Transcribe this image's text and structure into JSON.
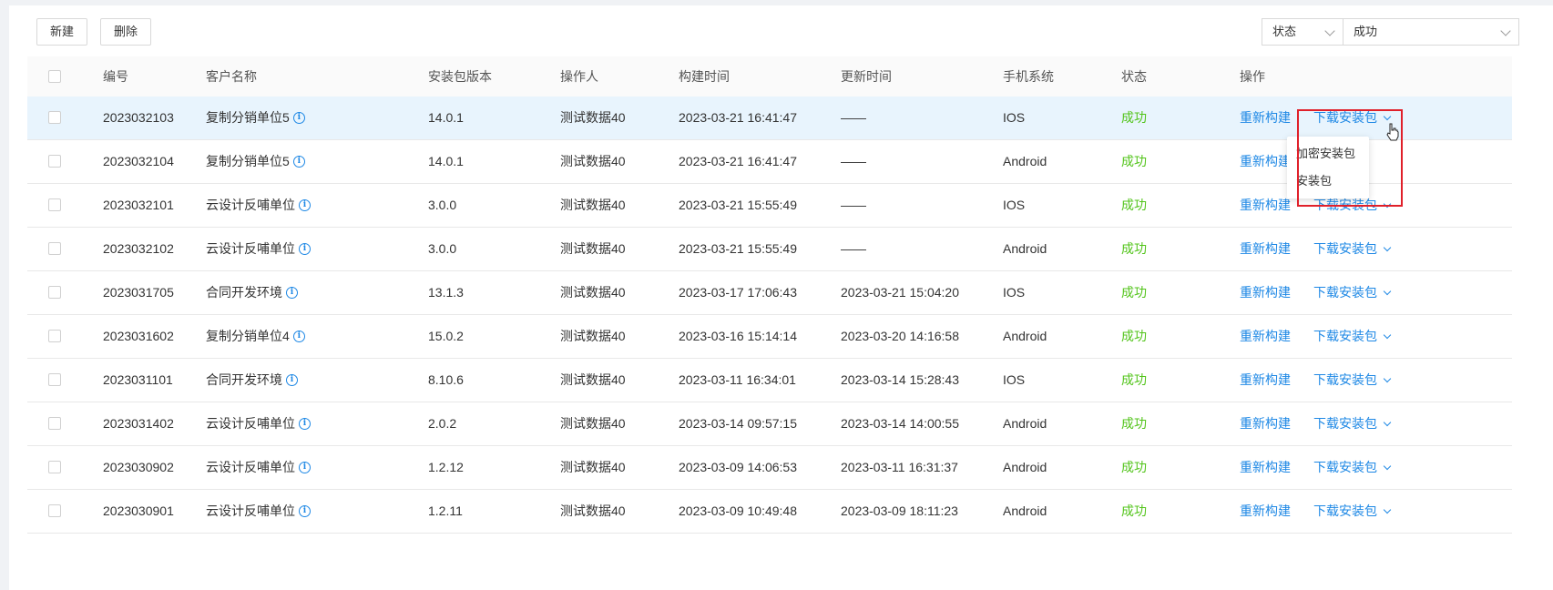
{
  "toolbar": {
    "new_label": "新建",
    "delete_label": "删除"
  },
  "filter": {
    "field_label": "状态",
    "value_label": "成功"
  },
  "columns": [
    "编号",
    "客户名称",
    "安装包版本",
    "操作人",
    "构建时间",
    "更新时间",
    "手机系统",
    "状态",
    "操作"
  ],
  "rows": [
    {
      "id": "2023032103",
      "customer": "复制分销单位5",
      "version": "14.0.1",
      "operator": "测试数据40",
      "build": "2023-03-21 16:41:47",
      "update": "——",
      "os": "IOS",
      "status": "成功",
      "rebuild": "重新构建",
      "download": "下载安装包"
    },
    {
      "id": "2023032104",
      "customer": "复制分销单位5",
      "version": "14.0.1",
      "operator": "测试数据40",
      "build": "2023-03-21 16:41:47",
      "update": "——",
      "os": "Android",
      "status": "成功",
      "rebuild": "重新构建",
      "download": ""
    },
    {
      "id": "2023032101",
      "customer": "云设计反哺单位",
      "version": "3.0.0",
      "operator": "测试数据40",
      "build": "2023-03-21 15:55:49",
      "update": "——",
      "os": "IOS",
      "status": "成功",
      "rebuild": "重新构建",
      "download": "下载安装包"
    },
    {
      "id": "2023032102",
      "customer": "云设计反哺单位",
      "version": "3.0.0",
      "operator": "测试数据40",
      "build": "2023-03-21 15:55:49",
      "update": "——",
      "os": "Android",
      "status": "成功",
      "rebuild": "重新构建",
      "download": "下载安装包"
    },
    {
      "id": "2023031705",
      "customer": "合同开发环境",
      "version": "13.1.3",
      "operator": "测试数据40",
      "build": "2023-03-17 17:06:43",
      "update": "2023-03-21 15:04:20",
      "os": "IOS",
      "status": "成功",
      "rebuild": "重新构建",
      "download": "下载安装包"
    },
    {
      "id": "2023031602",
      "customer": "复制分销单位4",
      "version": "15.0.2",
      "operator": "测试数据40",
      "build": "2023-03-16 15:14:14",
      "update": "2023-03-20 14:16:58",
      "os": "Android",
      "status": "成功",
      "rebuild": "重新构建",
      "download": "下载安装包"
    },
    {
      "id": "2023031101",
      "customer": "合同开发环境",
      "version": "8.10.6",
      "operator": "测试数据40",
      "build": "2023-03-11 16:34:01",
      "update": "2023-03-14 15:28:43",
      "os": "IOS",
      "status": "成功",
      "rebuild": "重新构建",
      "download": "下载安装包"
    },
    {
      "id": "2023031402",
      "customer": "云设计反哺单位",
      "version": "2.0.2",
      "operator": "测试数据40",
      "build": "2023-03-14 09:57:15",
      "update": "2023-03-14 14:00:55",
      "os": "Android",
      "status": "成功",
      "rebuild": "重新构建",
      "download": "下载安装包"
    },
    {
      "id": "2023030902",
      "customer": "云设计反哺单位",
      "version": "1.2.12",
      "operator": "测试数据40",
      "build": "2023-03-09 14:06:53",
      "update": "2023-03-11 16:31:37",
      "os": "Android",
      "status": "成功",
      "rebuild": "重新构建",
      "download": "下载安装包"
    },
    {
      "id": "2023030901",
      "customer": "云设计反哺单位",
      "version": "1.2.11",
      "operator": "测试数据40",
      "build": "2023-03-09 10:49:48",
      "update": "2023-03-09 18:11:23",
      "os": "Android",
      "status": "成功",
      "rebuild": "重新构建",
      "download": "下载安装包"
    }
  ],
  "dropdown": {
    "items": [
      "加密安装包",
      "安装包"
    ]
  },
  "info_glyph": "i",
  "colors": {
    "link": "#1e88e5",
    "success": "#52c41a",
    "highlight_row": "#e8f4fd",
    "annotation": "#e0202a"
  }
}
